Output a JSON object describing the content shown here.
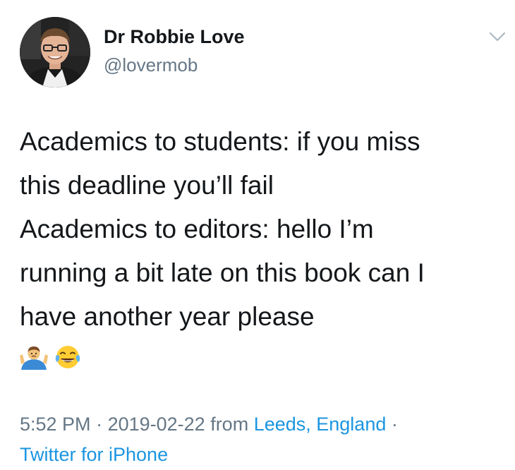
{
  "author": {
    "name": "Dr Robbie Love",
    "handle": "@lovermob"
  },
  "tweet": {
    "lines": [
      "Academics to students: if you miss",
      "this deadline you’ll fail",
      "Academics to editors: hello I’m",
      "running a bit late on this book can I",
      "have another year please"
    ],
    "emojis": [
      "person-shrugging-emoji",
      "face-with-tears-of-joy-emoji"
    ]
  },
  "meta": {
    "time": "5:52 PM",
    "separator": " · ",
    "date": "2019-02-22",
    "from": " from ",
    "location": "Leeds, England",
    "separator2": " ·",
    "source": "Twitter for iPhone"
  },
  "colors": {
    "text": "#14171a",
    "muted": "#657786",
    "link": "#1b95e0"
  },
  "icons": {
    "menu": "chevron-down-icon"
  }
}
